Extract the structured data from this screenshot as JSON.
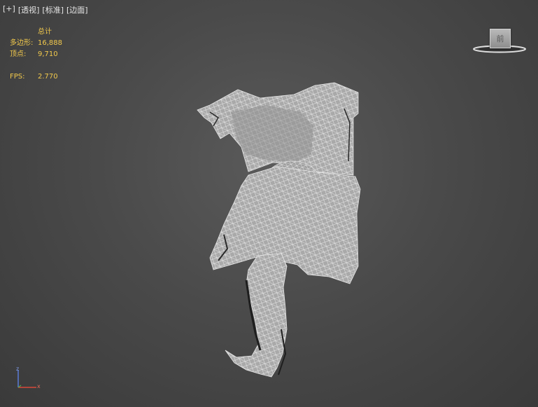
{
  "viewport": {
    "labels": [
      "[+]",
      "[透视]",
      "[标准]",
      "[边面]"
    ]
  },
  "stats": {
    "header": "总计",
    "polygons_label": "多边形:",
    "polygons_value": "16,888",
    "vertices_label": "顶点:",
    "vertices_value": "9,710",
    "fps_label": "FPS:",
    "fps_value": "2.770"
  },
  "viewcube": {
    "face_label": "前"
  },
  "axis_gizmo": {
    "z_label": "z",
    "x_label": "x"
  },
  "colors": {
    "stats_text": "#f2c94c",
    "mesh_fill": "#a9a9a9",
    "wire": "#e8e8e8",
    "axis_z": "#5a7bd8",
    "axis_x": "#d84a3a"
  }
}
